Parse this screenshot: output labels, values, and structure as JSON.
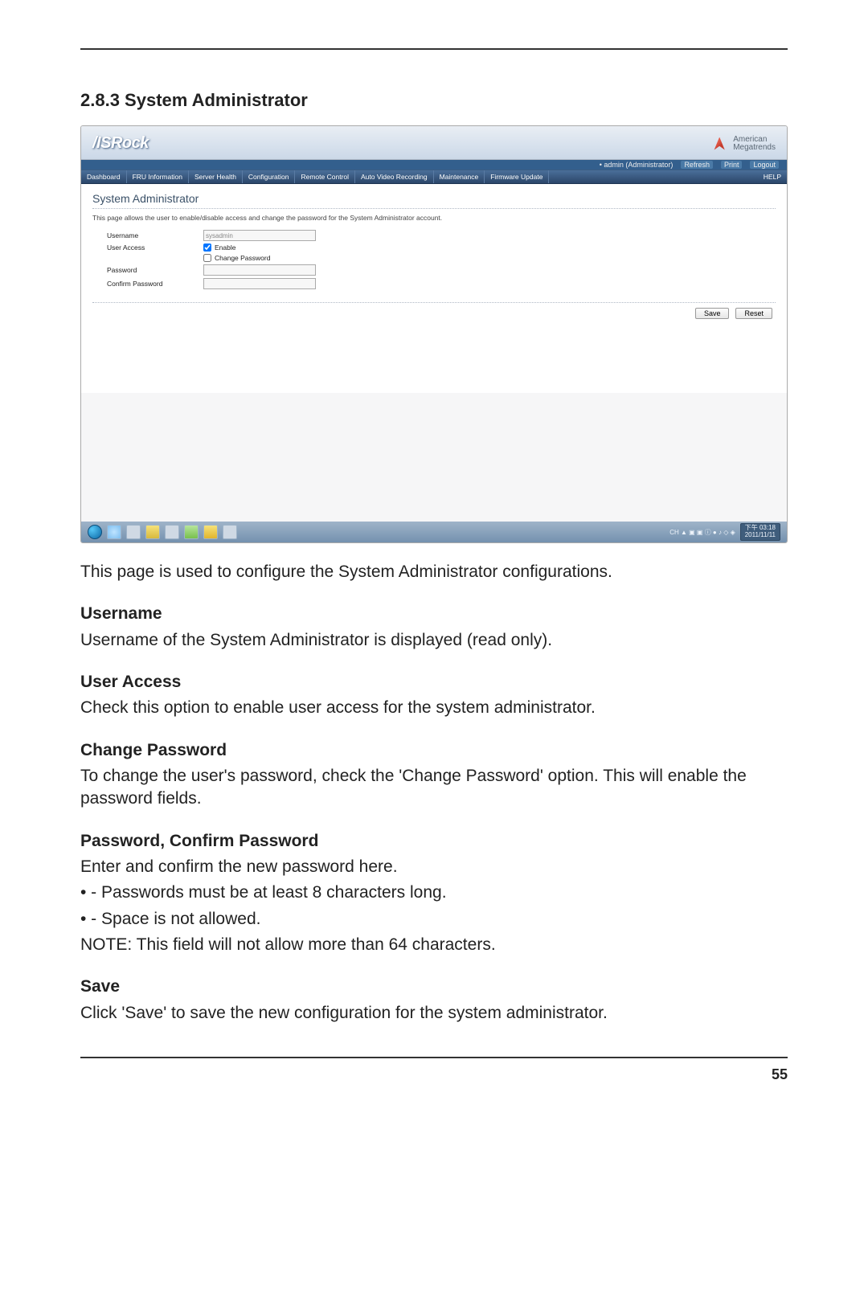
{
  "page": {
    "section_number_title": "2.8.3  System Administrator",
    "page_number": "55"
  },
  "ui": {
    "brand": "/ISRock",
    "ami": {
      "line1": "American",
      "line2": "Megatrends"
    },
    "subheader": {
      "welcome": "• admin (Administrator)",
      "refresh": "Refresh",
      "print": "Print",
      "logout": "Logout"
    },
    "nav": {
      "items": [
        "Dashboard",
        "FRU Information",
        "Server Health",
        "Configuration",
        "Remote Control",
        "Auto Video Recording",
        "Maintenance",
        "Firmware Update"
      ],
      "help": "HELP"
    },
    "panel": {
      "title": "System Administrator",
      "desc": "This page allows the user to enable/disable access and change the password for the System Administrator account.",
      "labels": {
        "username": "Username",
        "user_access": "User Access",
        "change_password": "Change Password",
        "password": "Password",
        "confirm_password": "Confirm Password"
      },
      "values": {
        "username": "sysadmin",
        "enable_label": "Enable"
      },
      "buttons": {
        "save": "Save",
        "reset": "Reset"
      }
    },
    "taskbar": {
      "time": "下午 03:18",
      "date": "2011/11/11",
      "tray": "CH ▲ ▣ ▣ ⓘ ● ♪ ◇ ◈"
    }
  },
  "doc": {
    "intro": "This page is used to configure the System Administrator configurations.",
    "username_h": "Username",
    "username_p": "Username of the System Administrator is displayed (read only).",
    "ua_h": "User Access",
    "ua_p": "Check this option to enable user access for the system administrator.",
    "cp_h": "Change Password",
    "cp_p": "To change the user's password, check the 'Change Password' option. This will enable the password fields.",
    "pcp_h": "Password, Confirm Password",
    "pcp_p1": "Enter and confirm the new password here.",
    "pcp_b1": "• - Passwords must be at least 8 characters long.",
    "pcp_b2": "• - Space is not allowed.",
    "pcp_note": "NOTE: This field will not allow more than 64 characters.",
    "save_h": "Save",
    "save_p": "Click 'Save' to save the new configuration for the system administrator."
  }
}
